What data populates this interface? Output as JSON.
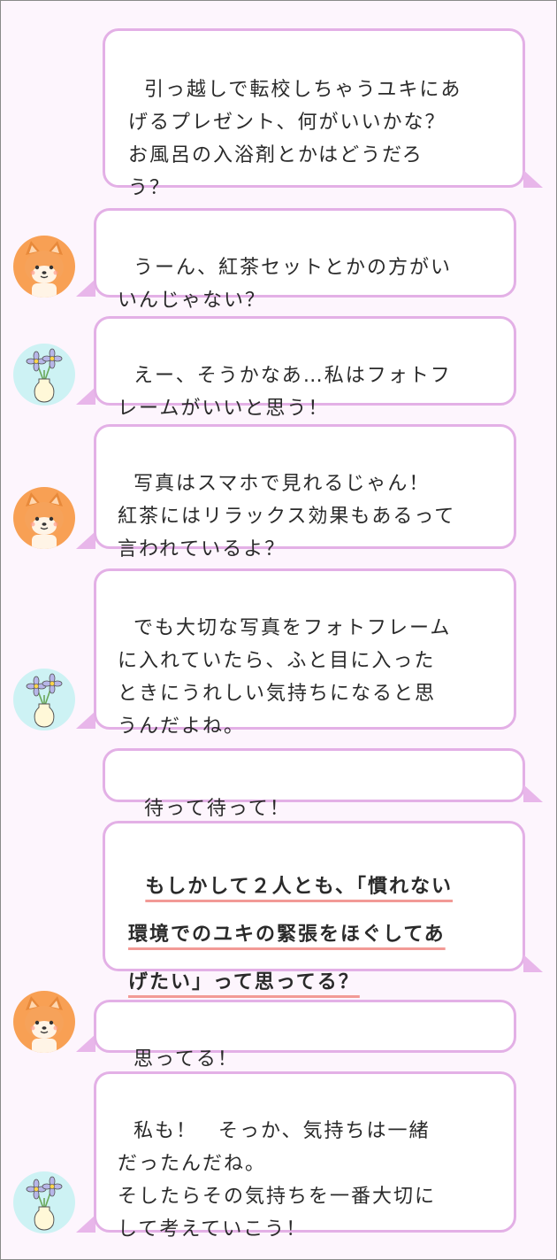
{
  "messages": [
    {
      "speaker": "narrator",
      "side": "right",
      "text": "引っ越しで転校しちゃうユキにあ\nげるプレゼント、何がいいかな？\nお風呂の入浴剤とかはどうだろ\nう？"
    },
    {
      "speaker": "shiba",
      "side": "left",
      "avatar_icon": "shiba-dog-icon",
      "text": "うーん、紅茶セットとかの方がい\nいんじゃない？"
    },
    {
      "speaker": "flower",
      "side": "left",
      "avatar_icon": "flower-vase-icon",
      "text": "えー、そうかなあ…私はフォトフ\nレームがいいと思う！"
    },
    {
      "speaker": "shiba",
      "side": "left",
      "avatar_icon": "shiba-dog-icon",
      "text": "写真はスマホで見れるじゃん！\n紅茶にはリラックス効果もあるって\n言われているよ？"
    },
    {
      "speaker": "flower",
      "side": "left",
      "avatar_icon": "flower-vase-icon",
      "text": "でも大切な写真をフォトフレーム\nに入れていたら、ふと目に入った\nときにうれしい気持ちになると思\nうんだよね。"
    },
    {
      "speaker": "narrator",
      "side": "right",
      "text": "待って待って！"
    },
    {
      "speaker": "narrator",
      "side": "right",
      "emphasis": "bold-underline",
      "text": "もしかして２人とも、「慣れない\n環境でのユキの緊張をほぐしてあ\nげたい」って思ってる？"
    },
    {
      "speaker": "shiba",
      "side": "left",
      "avatar_icon": "shiba-dog-icon",
      "text": "思ってる！"
    },
    {
      "speaker": "flower",
      "side": "left",
      "avatar_icon": "flower-vase-icon",
      "text": "私も！　そっか、気持ちは一緒\nだったんだね。\nそしたらその気持ちを一番大切に\nして考えていこう！"
    }
  ],
  "colors": {
    "background": "#fdf5fd",
    "bubble_border": "#e3b0e6",
    "underline": "#f29a96",
    "shiba_avatar_bg": "#f8a054",
    "flower_avatar_bg": "#cdf2f4"
  }
}
